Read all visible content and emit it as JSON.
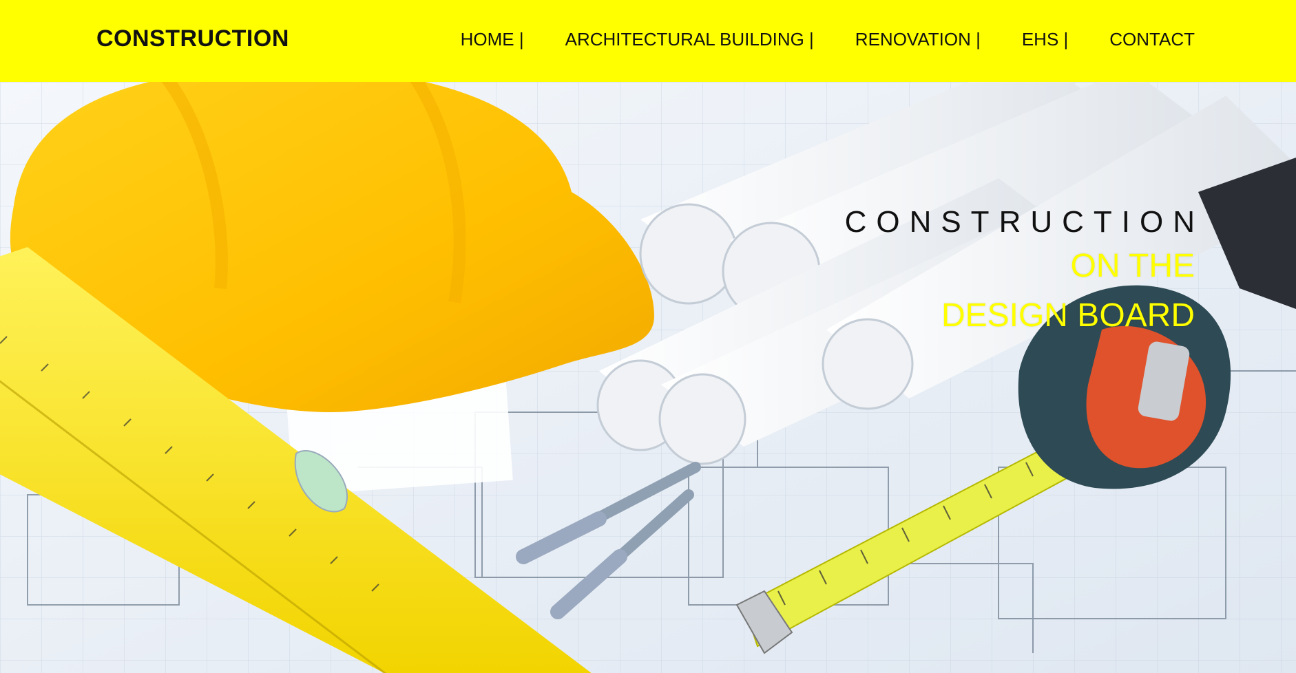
{
  "brand": {
    "name": "CONSTRUCTION"
  },
  "nav": {
    "items": [
      {
        "label": "HOME |"
      },
      {
        "label": "ARCHITECTURAL BUILDING |"
      },
      {
        "label": "RENOVATION |"
      },
      {
        "label": "EHS |"
      },
      {
        "label": "CONTACT"
      }
    ]
  },
  "hero": {
    "line1": "CONSTRUCTION",
    "line2": "ON THE",
    "line3": "DESIGN BOARD",
    "image": "construction-blueprints-hardhat-level-tape-measure"
  },
  "colors": {
    "accent": "#ffff00",
    "text": "#111111"
  }
}
